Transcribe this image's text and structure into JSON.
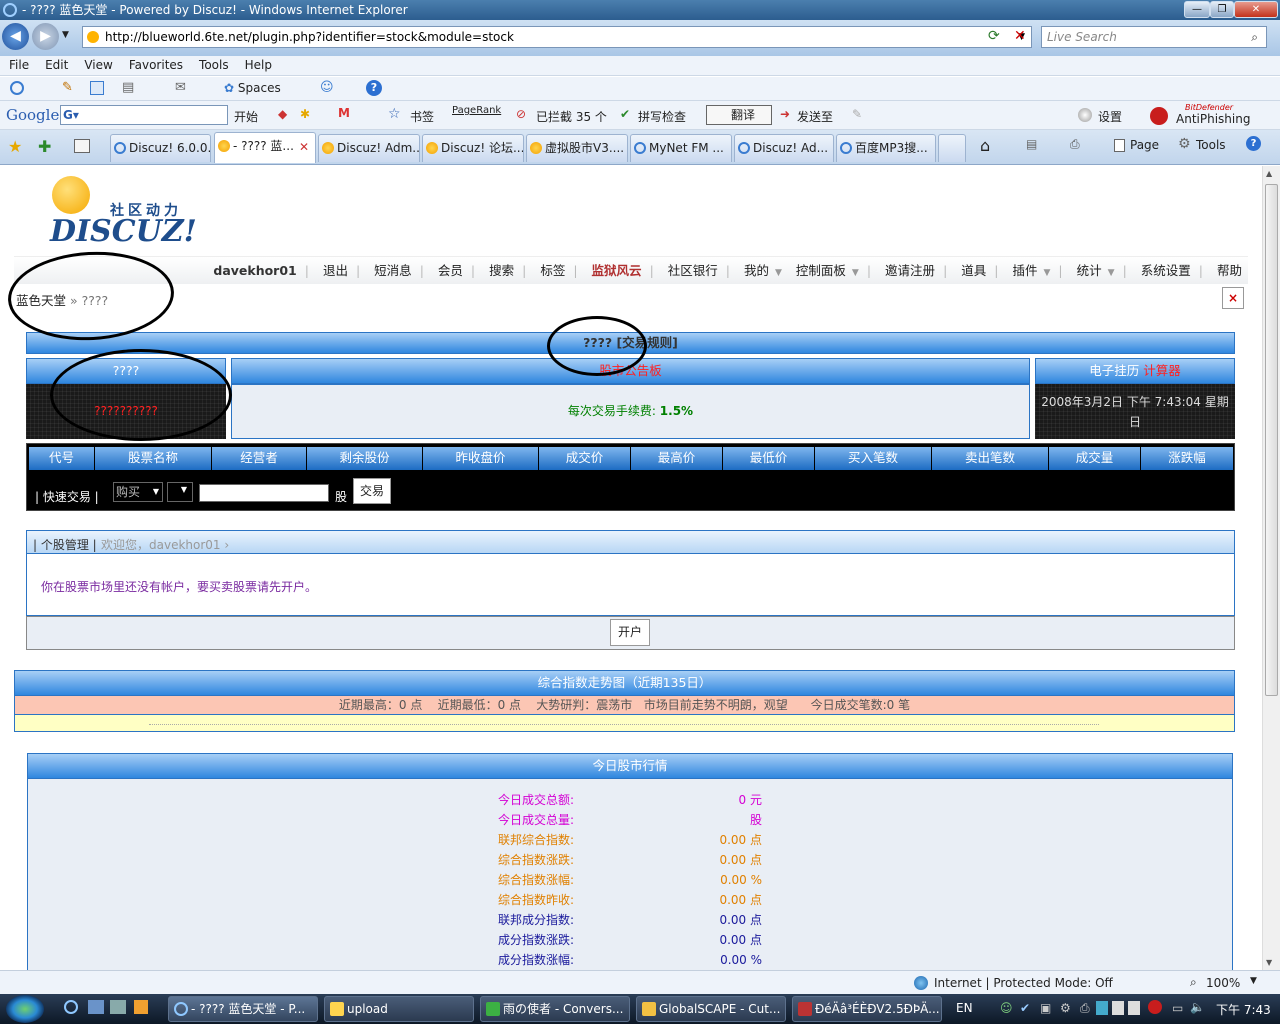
{
  "window": {
    "title": "- ???? 蓝色天堂 - Powered by Discuz! - Windows Internet Explorer"
  },
  "address": {
    "url": "http://blueworld.6te.net/plugin.php?identifier=stock&module=stock",
    "search_placeholder": "Live Search"
  },
  "menu": [
    "File",
    "Edit",
    "View",
    "Favorites",
    "Tools",
    "Help"
  ],
  "toolbar1": {
    "spaces": "Spaces"
  },
  "google_toolbar": {
    "logo": "Google",
    "go": "开始",
    "bookmarks": "书签",
    "pagerank": "PageRank",
    "blocked": "已拦截 35 个",
    "spellcheck": "拼写检查",
    "translate": "翻译",
    "sendto": "发送至",
    "settings": "设置",
    "antiphishing_brand": "AntiPhishing",
    "antiphishing_top": "BitDefender"
  },
  "tabs": [
    "Discuz! 6.0.0...",
    "- ???? 蓝...",
    "Discuz! Adm...",
    "Discuz! 论坛...",
    "虚拟股市V3....",
    "MyNet FM ...",
    "Discuz! Ad...",
    "百度MP3搜..."
  ],
  "cmdbar": {
    "page": "Page",
    "tools": "Tools"
  },
  "page": {
    "logo_sub": "社区动力",
    "logo_main": "DISCUZ!",
    "nav": [
      "davekhor01",
      "退出",
      "短消息",
      "会员",
      "搜索",
      "标签",
      "监狱风云",
      "社区银行",
      "我的",
      "控制面板",
      "邀请注册",
      "道具",
      "插件",
      "统计",
      "系统设置",
      "帮助"
    ],
    "crumb_home": "蓝色天堂",
    "crumb_sep": "»",
    "crumb_current": "????",
    "close": "×",
    "main_title": "???? [交易规则]",
    "left_header": "????",
    "left_value": "??????????",
    "center_header": "股市公告板",
    "fee_label": "每次交易手续费:",
    "fee_value": "1.5%",
    "right_header": "电子挂历",
    "right_header_link": "计算器",
    "datetime": "2008年3月2日 下午 7:43:04 星期日",
    "columns": [
      "代号",
      "股票名称",
      "经营者",
      "剩余股份",
      "昨收盘价",
      "成交价",
      "最高价",
      "最低价",
      "买入笔数",
      "卖出笔数",
      "成交量",
      "涨跌幅"
    ],
    "quick_trade": "| 快速交易 |",
    "trade_type": "购买",
    "shares_unit": "股",
    "trade_button": "交易",
    "personal_tab": "| 个股管理 |",
    "welcome": "欢迎您，davekhor01 ›",
    "no_account_msg": "你在股票市场里还没有帐户，要买卖股票请先开户。",
    "open_account": "开户",
    "index_title": "综合指数走势图（近期135日）",
    "index_info": "近期最高：0 点    近期最低：0 点    大势研判：震荡市   市场目前走势不明朗，观望      今日成交笔数:0 笔",
    "market_title": "今日股市行情",
    "market_rows": [
      {
        "label": "今日成交总额:",
        "value": "0 元",
        "color": "#d400d4"
      },
      {
        "label": "今日成交总量:",
        "value": "股",
        "color": "#d400d4"
      },
      {
        "label": "联邦综合指数:",
        "value": "0.00 点",
        "color": "#e08000"
      },
      {
        "label": "综合指数涨跌:",
        "value": "0.00 点",
        "color": "#e08000"
      },
      {
        "label": "综合指数涨幅:",
        "value": "0.00 %",
        "color": "#e08000"
      },
      {
        "label": "综合指数昨收:",
        "value": "0.00 点",
        "color": "#e08000"
      },
      {
        "label": "联邦成分指数:",
        "value": "0.00 点",
        "color": "#1a1a9c"
      },
      {
        "label": "成分指数涨跌:",
        "value": "0.00 点",
        "color": "#1a1a9c"
      },
      {
        "label": "成分指数涨幅:",
        "value": "0.00 %",
        "color": "#1a1a9c"
      }
    ]
  },
  "status": {
    "zone": "Internet | Protected Mode: Off",
    "zoom": "100%"
  },
  "taskbar": {
    "items": [
      "- ???? 蓝色天堂 - P...",
      "upload",
      "雨の使者 - Convers...",
      "GlobalSCAPE - Cut...",
      "ÐéÄâ³ÉÈÐV2.5ÐÞÄ..."
    ],
    "lang": "EN",
    "clock": "下午 7:43"
  },
  "colors": {
    "accent_blue": "#2f86df",
    "link_red": "#ff0000",
    "fee_green": "#008000"
  }
}
